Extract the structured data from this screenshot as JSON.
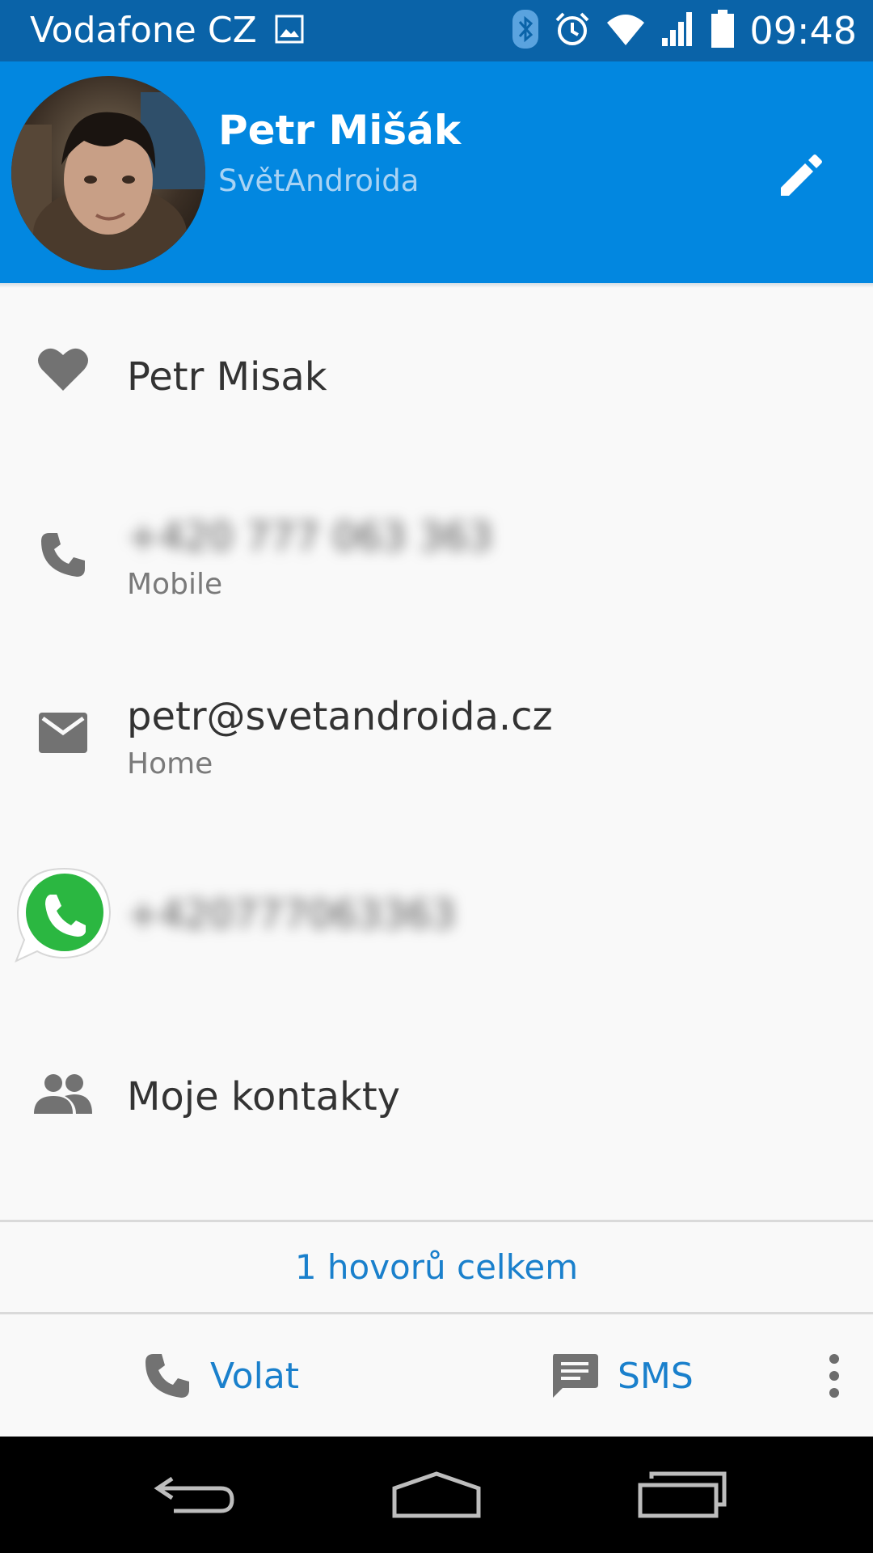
{
  "status_bar": {
    "carrier": "Vodafone CZ",
    "time": "09:48",
    "icons": [
      "image-notification-icon",
      "bluetooth-icon",
      "alarm-icon",
      "wifi-icon",
      "signal-icon",
      "battery-icon"
    ]
  },
  "header": {
    "name": "Petr Mišák",
    "company": "SvětAndroida",
    "background_color": "#0287e0"
  },
  "details": {
    "nickname": "Petr Misak",
    "phone": {
      "number": "+420 777 063 363",
      "type": "Mobile"
    },
    "email": {
      "address": "petr@svetandroida.cz",
      "type": "Home"
    },
    "whatsapp": {
      "number": "+420777063363"
    },
    "group": "Moje kontakty"
  },
  "call_history": "1 hovorů celkem",
  "actions": {
    "call_label": "Volat",
    "sms_label": "SMS"
  },
  "accent_color": "#1a80cc"
}
